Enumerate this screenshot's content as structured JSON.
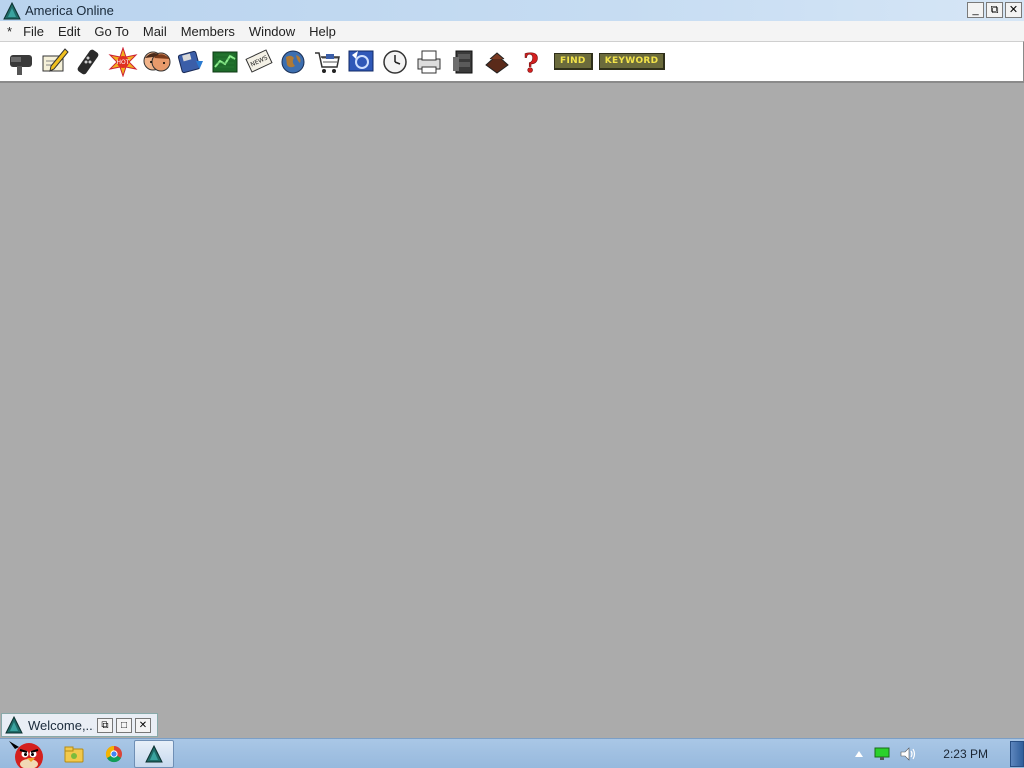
{
  "window": {
    "title": "America  Online",
    "controls": {
      "minimize": "_",
      "restore": "⧉",
      "close": "✕"
    }
  },
  "menubar": {
    "system_label": "*",
    "items": [
      "File",
      "Edit",
      "Go To",
      "Mail",
      "Members",
      "Window",
      "Help"
    ]
  },
  "toolbar": {
    "icons": [
      "mailbox-icon",
      "compose-mail-icon",
      "remote-icon",
      "whats-hot-icon",
      "people-connection-icon",
      "download-disk-icon",
      "stock-chart-icon",
      "news-icon",
      "world-globe-icon",
      "shopping-cart-icon",
      "internet-icon",
      "clock-icon",
      "print-icon",
      "file-cabinet-icon",
      "favorites-icon",
      "help-question-icon"
    ],
    "find_label": "FIND",
    "keyword_label": "KEYWORD"
  },
  "minimized_window": {
    "title": "Welcome,...",
    "controls": {
      "restore": "⧉",
      "maximize": "□",
      "close": "✕"
    }
  },
  "taskbar": {
    "apps": [
      "angry-birds-icon",
      "file-explorer-icon",
      "chrome-icon",
      "aol-icon"
    ],
    "active_app": "aol-icon",
    "tray": [
      "show-hidden-icons-icon",
      "network-icon",
      "volume-icon"
    ],
    "clock": "2:23 PM"
  },
  "colors": {
    "workspace": "#ababab",
    "titlebar": "#c6dcf2",
    "taskbar": "#9fc0e2",
    "keyword_button_bg": "#6b6b3c",
    "keyword_button_text": "#f2e34a"
  }
}
